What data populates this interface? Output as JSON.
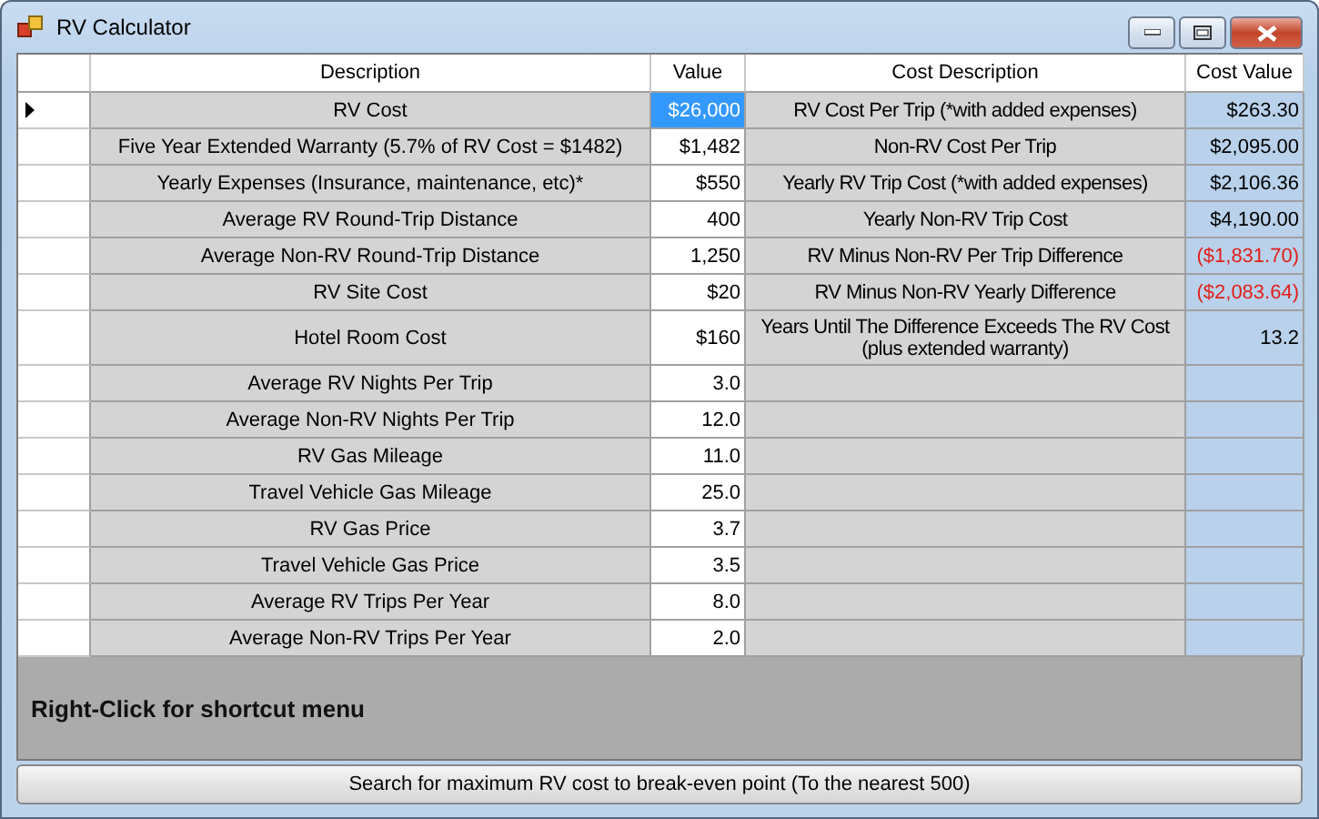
{
  "window": {
    "title": "RV Calculator"
  },
  "table": {
    "columns": [
      "Description",
      "Value",
      "Cost Description",
      "Cost Value"
    ],
    "rows": [
      {
        "current": true,
        "description": "RV Cost",
        "value": "$26,000",
        "selected": true,
        "cost_description": "RV Cost Per Trip (*with added expenses)",
        "cost_value": "$263.30",
        "negative": false
      },
      {
        "current": false,
        "description": "Five Year Extended Warranty (5.7% of RV Cost = $1482)",
        "value": "$1,482",
        "selected": false,
        "cost_description": "Non-RV Cost Per Trip",
        "cost_value": "$2,095.00",
        "negative": false
      },
      {
        "current": false,
        "description": "Yearly Expenses (Insurance, maintenance, etc)*",
        "value": "$550",
        "selected": false,
        "cost_description": "Yearly RV Trip Cost (*with added expenses)",
        "cost_value": "$2,106.36",
        "negative": false
      },
      {
        "current": false,
        "description": "Average RV Round-Trip Distance",
        "value": "400",
        "selected": false,
        "cost_description": "Yearly Non-RV Trip Cost",
        "cost_value": "$4,190.00",
        "negative": false
      },
      {
        "current": false,
        "description": "Average Non-RV Round-Trip Distance",
        "value": "1,250",
        "selected": false,
        "cost_description": "RV Minus Non-RV Per Trip Difference",
        "cost_value": "($1,831.70)",
        "negative": true
      },
      {
        "current": false,
        "description": "RV Site Cost",
        "value": "$20",
        "selected": false,
        "cost_description": "RV Minus Non-RV Yearly Difference",
        "cost_value": "($2,083.64)",
        "negative": true
      },
      {
        "current": false,
        "description": "Hotel Room Cost",
        "value": "$160",
        "selected": false,
        "cost_description": "Years Until The Difference Exceeds The RV Cost (plus extended warranty)",
        "cost_value": "13.2",
        "negative": false
      },
      {
        "current": false,
        "description": "Average RV Nights Per Trip",
        "value": "3.0",
        "selected": false
      },
      {
        "current": false,
        "description": "Average Non-RV Nights Per Trip",
        "value": "12.0",
        "selected": false
      },
      {
        "current": false,
        "description": "RV Gas Mileage",
        "value": "11.0",
        "selected": false
      },
      {
        "current": false,
        "description": "Travel Vehicle Gas Mileage",
        "value": "25.0",
        "selected": false
      },
      {
        "current": false,
        "description": "RV Gas Price",
        "value": "3.7",
        "selected": false
      },
      {
        "current": false,
        "description": "Travel Vehicle Gas Price",
        "value": "3.5",
        "selected": false
      },
      {
        "current": false,
        "description": "Average RV Trips Per Year",
        "value": "8.0",
        "selected": false
      },
      {
        "current": false,
        "description": "Average Non-RV Trips Per Year",
        "value": "2.0",
        "selected": false
      }
    ]
  },
  "hint": "Right-Click for shortcut menu",
  "search_button": "Search for maximum RV cost to break-even point (To the nearest 500)"
}
